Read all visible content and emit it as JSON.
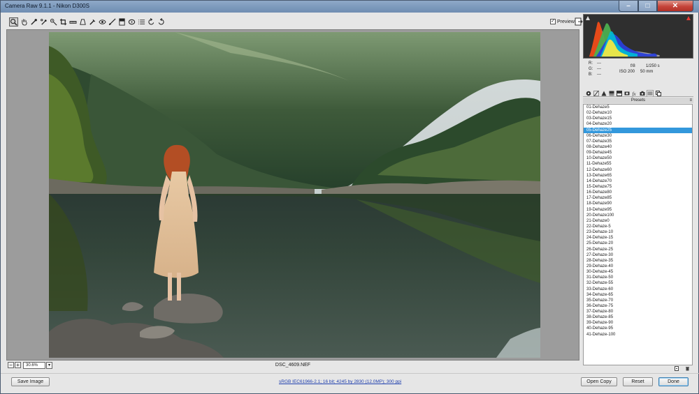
{
  "window": {
    "title": "Camera Raw 9.1.1  -  Nikon D300S",
    "minimize_glyph": "–",
    "maximize_glyph": "□",
    "close_glyph": "✕"
  },
  "toolbar": {
    "tools": [
      "zoom-tool",
      "hand-tool",
      "white-balance-tool",
      "color-sampler-tool",
      "targeted-adjustment-tool",
      "crop-tool",
      "straighten-tool",
      "transform-tool",
      "spot-removal-tool",
      "red-eye-tool",
      "adjustment-brush",
      "graduated-filter",
      "radial-filter",
      "open-preferences",
      "rotate-ccw",
      "rotate-cw"
    ],
    "preview_label": "Preview",
    "preview_checked": "✓"
  },
  "image": {
    "filename": "DSC_4609.NEF",
    "zoom": "30.6%",
    "zoom_out": "−",
    "zoom_in": "+",
    "zoom_dropdown": "▾"
  },
  "readout": {
    "r_label": "R:",
    "r_value": "---",
    "g_label": "G:",
    "g_value": "---",
    "b_label": "B:",
    "b_value": "---",
    "aperture": "f/8",
    "shutter": "1/250 s",
    "iso": "ISO 200",
    "focal": "50 mm"
  },
  "panel": {
    "title": "Presets",
    "menu_glyph": "≡",
    "selected_index": 4,
    "presets": [
      "01-Dehaze5",
      "02-Dehaze10",
      "03-Dehaze15",
      "04-Dehaze20",
      "05-Dehaze25",
      "06-Dehaze30",
      "07-Dehaze35",
      "08-Dehaze40",
      "09-Dehaze45",
      "10-Dehaze50",
      "11-Dehaze55",
      "12-Dehaze60",
      "13-Dehaze65",
      "14-Dehaze70",
      "15-Dehaze75",
      "16-Dehaze80",
      "17-Dehaze85",
      "18-Dehaze90",
      "19-Dehaze95",
      "20-Dehaze100",
      "21-Dehaze0",
      "22-Dehaze-5",
      "23-Dehaze-10",
      "24-Dehaze-15",
      "25-Dehaze-20",
      "26-Dehaze-25",
      "27-Dehaze-30",
      "28-Dehaze-35",
      "29-Dehaze-40",
      "30-Dehaze-45",
      "31-Dehaze-50",
      "32-Dehaze-55",
      "33-Dehaze-60",
      "34-Dehaze-65",
      "35-Dehaze-70",
      "36-Dehaze-75",
      "37-Dehaze-80",
      "38-Dehaze-85",
      "39-Dehaze-90",
      "40-Dehaze-95",
      "41-Dehaze-100"
    ]
  },
  "footer": {
    "save_label": "Save Image",
    "workflow_link": "sRGB IEC61966-2.1; 16 bit; 4245 by 2830 (12.0MP); 300 ppi",
    "open_label": "Open Copy",
    "reset_label": "Reset",
    "done_label": "Done"
  },
  "colors": {
    "selection": "#3398dc",
    "link": "#1f3fae",
    "canvas_bg": "#9c9c9c"
  }
}
